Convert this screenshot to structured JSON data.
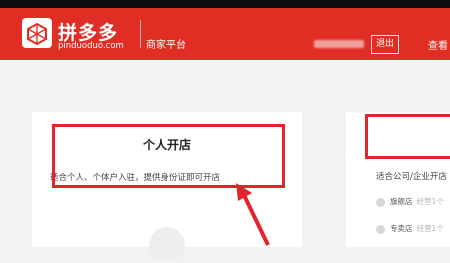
{
  "header": {
    "brand_cn": "拼多多",
    "brand_en": "pinduoduo.com",
    "portal_name": "商家平台",
    "logout_label": "退出",
    "link_label": "查看"
  },
  "cards": {
    "personal": {
      "title": "个人开店",
      "description": "适合个人、个体户入驻，提供身份证即可开店"
    },
    "enterprise": {
      "description": "适合公司/企业开店",
      "options": [
        {
          "label": "旗舰店",
          "sub": "经营1个"
        },
        {
          "label": "专卖店",
          "sub": "经营1个"
        }
      ]
    }
  },
  "colors": {
    "brand_red": "#e02e24",
    "annotation_red": "#e3242b",
    "page_bg": "#f2f2f2"
  }
}
